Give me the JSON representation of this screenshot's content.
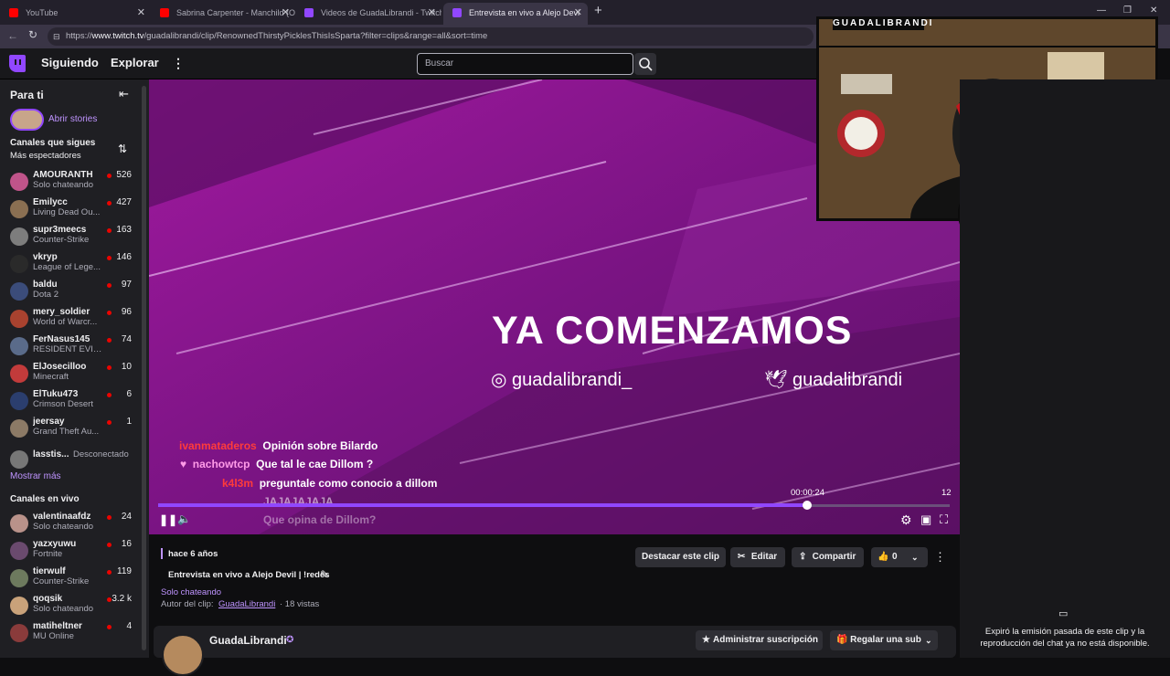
{
  "browser": {
    "tabs": [
      {
        "label": "YouTube",
        "active": false
      },
      {
        "label": "Sabrina Carpenter - Manchild (Offi",
        "active": false
      },
      {
        "label": "Videos de GuadaLibrandi - Twitch",
        "active": false
      },
      {
        "label": "Entrevista en vivo a Alejo Devi",
        "active": true
      }
    ],
    "url_prefix": "https://",
    "url_host": "www.twitch.tv",
    "url_path": "/guadalibrandi/clip/RenownedThirstyPicklesThisIsSparta?filter=clips&range=all&sort=time"
  },
  "topnav": {
    "following": "Siguiendo",
    "browse": "Explorar",
    "search_placeholder": "Buscar"
  },
  "sidebar": {
    "for_you": "Para ti",
    "open_stories": "Abrir stories",
    "followed_header": "Canales que sigues",
    "followed_sort": "Más espectadores",
    "followed": [
      {
        "name": "AMOURANTH",
        "game": "Solo chateando",
        "viewers": "526",
        "color": "#c0548a"
      },
      {
        "name": "Emilycc",
        "game": "Living Dead Ou...",
        "viewers": "427",
        "color": "#8a6f52"
      },
      {
        "name": "supr3meecs",
        "game": "Counter-Strike",
        "viewers": "163",
        "color": "#7d7d7d"
      },
      {
        "name": "vkryp",
        "game": "League of Lege...",
        "viewers": "146",
        "color": "#2a2a2a"
      },
      {
        "name": "baldu",
        "game": "Dota 2",
        "viewers": "97",
        "color": "#3b4c7a"
      },
      {
        "name": "mery_soldier",
        "game": "World of Warcr...",
        "viewers": "96",
        "color": "#a8422f"
      },
      {
        "name": "FerNasus145",
        "game": "RESIDENT EVIL...",
        "viewers": "74",
        "color": "#5a6b8a"
      },
      {
        "name": "ElJosecilloo",
        "game": "Minecraft",
        "viewers": "10",
        "color": "#c23b3b"
      },
      {
        "name": "ElTuku473",
        "game": "Crimson Desert",
        "viewers": "6",
        "color": "#2b3e6e"
      },
      {
        "name": "jeersay",
        "game": "Grand Theft Au...",
        "viewers": "1",
        "color": "#8c7a66"
      }
    ],
    "offline_name": "lasstis...",
    "offline_label": "Desconectado",
    "show_more": "Mostrar más",
    "live_header": "Canales en vivo",
    "live": [
      {
        "name": "valentinaafdz",
        "game": "Solo chateando",
        "viewers": "24",
        "color": "#b9928a"
      },
      {
        "name": "yazxyuwu",
        "game": "Fortnite",
        "viewers": "16",
        "color": "#6a4a6e"
      },
      {
        "name": "tierwulf",
        "game": "Counter-Strike",
        "viewers": "119",
        "color": "#6d7a5e"
      },
      {
        "name": "qoqsik",
        "game": "Solo chateando",
        "viewers": "3.2 k",
        "color": "#c9a27a"
      },
      {
        "name": "matiheltner",
        "game": "MU Online",
        "viewers": "4",
        "color": "#8a3b3b"
      }
    ]
  },
  "player": {
    "title_overlay": "YA COMENZAMOS",
    "instagram": "guadalibrandi_",
    "twitter": "guadalibrandi",
    "cam_label": "GUADALIBRANDI",
    "chat": [
      {
        "user": "ivanmataderos",
        "msg": "Opinión sobre Bilardo",
        "color": "#ff3b3b"
      },
      {
        "user": "nachowtcp",
        "msg": "Que tal le cae Dillom ?",
        "color": "#ff9be8"
      },
      {
        "user": "k4l3m",
        "msg": "preguntale como conocio a dillom",
        "color": "#ff3b3b"
      },
      {
        "user": "",
        "msg": "JAJAJAJAJA",
        "color": "#ffffff"
      },
      {
        "user": "",
        "msg": "Que opina de Dillom?",
        "color": "#ffffff"
      }
    ],
    "time_current": "00:00:24",
    "time_end": "12",
    "progress": 0.82
  },
  "clip": {
    "age": "hace 6 años",
    "title": "Entrevista en vivo a Alejo Devil | !redes",
    "category": "Solo chateando",
    "author_label": "Autor del clip:",
    "author": "GuadaLibrandi",
    "views": "· 18 vistas",
    "feature": "Destacar este clip",
    "edit": "Editar",
    "share": "Compartir",
    "likes": "0"
  },
  "channel": {
    "name": "GuadaLibrandi",
    "manage_sub": "Administrar suscripción",
    "gift_sub": "Regalar una sub"
  },
  "chat_panel": {
    "expired": "Expiró la emisión pasada de este clip y la reproducción del chat ya no está disponible."
  }
}
